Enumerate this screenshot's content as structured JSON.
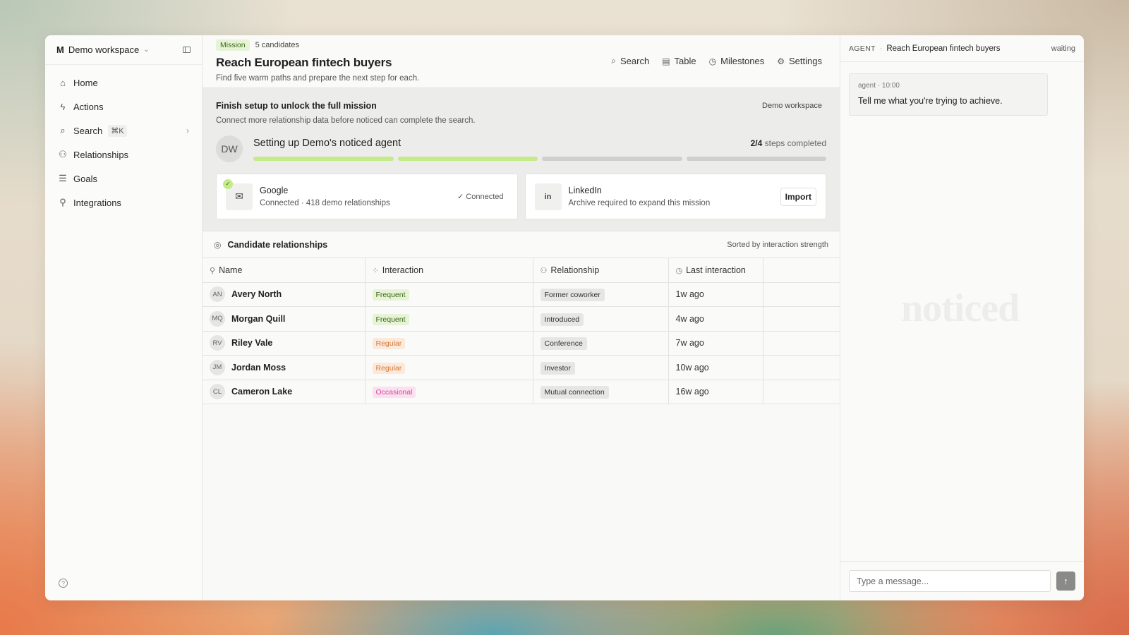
{
  "sidebar": {
    "workspace_logo": "M",
    "workspace_name": "Demo workspace",
    "items": [
      {
        "label": "Home",
        "icon": "home-icon"
      },
      {
        "label": "Actions",
        "icon": "bolt-icon"
      },
      {
        "label": "Search",
        "icon": "search-icon",
        "shortcut": "⌘K"
      },
      {
        "label": "Relationships",
        "icon": "people-icon"
      },
      {
        "label": "Goals",
        "icon": "list-icon"
      },
      {
        "label": "Integrations",
        "icon": "plug-icon"
      }
    ]
  },
  "header": {
    "badge": "Mission",
    "candidates": "5 candidates",
    "title": "Reach European fintech buyers",
    "subtitle": "Find five warm paths and prepare the next step for each.",
    "toolbar": [
      "Search",
      "Table",
      "Milestones",
      "Settings"
    ]
  },
  "setup": {
    "title": "Finish setup to unlock the full mission",
    "desc": "Connect more relationship data before noticed can complete the search.",
    "workspace": "Demo workspace",
    "avatar": "DW",
    "agent_title": "Setting up Demo's noticed agent",
    "steps_done": "2/4",
    "steps_label": "steps completed",
    "progress": {
      "completed": 2,
      "total": 4
    },
    "google": {
      "name": "Google",
      "sub": "Connected · 418 demo relationships",
      "status": "Connected"
    },
    "linkedin": {
      "name": "LinkedIn",
      "sub": "Archive required to expand this mission",
      "button": "Import"
    }
  },
  "candidates": {
    "title": "Candidate relationships",
    "sorted": "Sorted by interaction strength",
    "columns": [
      "Name",
      "Interaction",
      "Relationship",
      "Last interaction"
    ],
    "rows": [
      {
        "initials": "AN",
        "name": "Avery North",
        "interaction": "Frequent",
        "relationship": "Former coworker",
        "last": "1w ago"
      },
      {
        "initials": "MQ",
        "name": "Morgan Quill",
        "interaction": "Frequent",
        "relationship": "Introduced",
        "last": "4w ago"
      },
      {
        "initials": "RV",
        "name": "Riley Vale",
        "interaction": "Regular",
        "relationship": "Conference",
        "last": "7w ago"
      },
      {
        "initials": "JM",
        "name": "Jordan Moss",
        "interaction": "Regular",
        "relationship": "Investor",
        "last": "10w ago"
      },
      {
        "initials": "CL",
        "name": "Cameron Lake",
        "interaction": "Occasional",
        "relationship": "Mutual connection",
        "last": "16w ago"
      }
    ]
  },
  "pane": {
    "label": "AGENT",
    "title": "Reach European fintech buyers",
    "status": "waiting",
    "message_meta": "agent · 10:00",
    "message_text": "Tell me what you're trying to achieve.",
    "watermark": "noticed",
    "placeholder": "Type a message..."
  }
}
